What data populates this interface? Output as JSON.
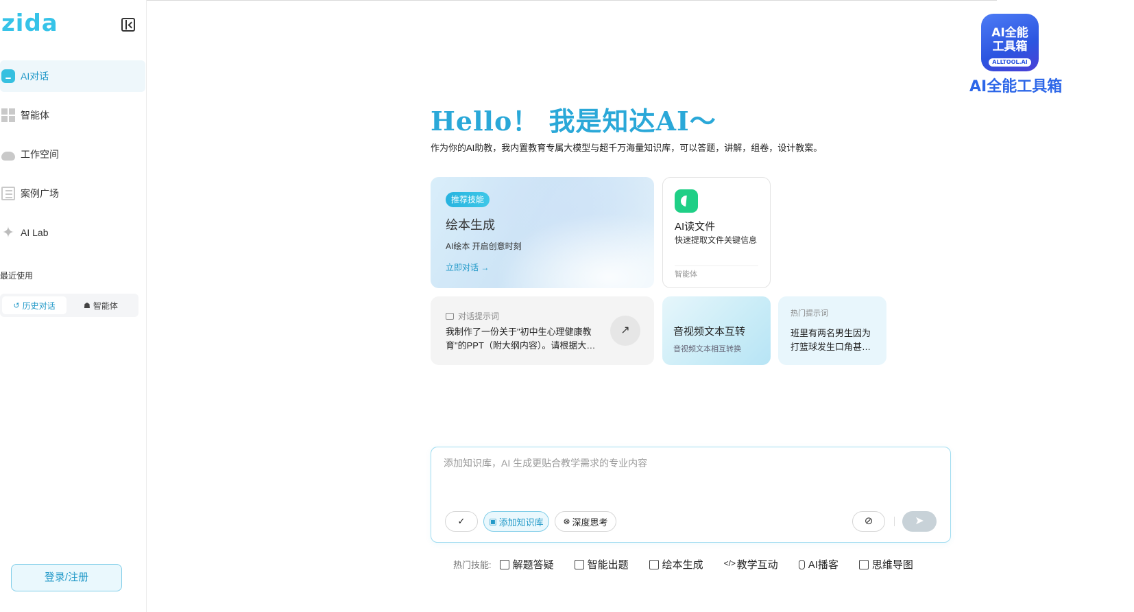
{
  "sidebar": {
    "logo": "zida",
    "nav": [
      {
        "label": "AI对话",
        "icon": "chat-icon",
        "active": true
      },
      {
        "label": "智能体",
        "icon": "grid-icon",
        "active": false
      },
      {
        "label": "工作空间",
        "icon": "cloud-icon",
        "active": false
      },
      {
        "label": "案例广场",
        "icon": "list-icon",
        "active": false
      },
      {
        "label": "AI Lab",
        "icon": "sparkle-icon",
        "active": false
      }
    ],
    "recent_title": "最近使用",
    "recent_tabs": [
      {
        "label": "历史对话",
        "icon": "history-icon",
        "active": true
      },
      {
        "label": "智能体",
        "icon": "agent-icon",
        "active": false
      }
    ],
    "login_label": "登录/注册"
  },
  "main": {
    "hello": "Hello！ 我是知达AI～",
    "subtitle": "作为你的AI助教，我内置教育专属大模型与超千万海量知识库，可以答题，讲解，组卷，设计教案。",
    "feature_card": {
      "badge": "推荐技能",
      "title": "绘本生成",
      "desc": "AI绘本 开启创意时刻",
      "link": "立即对话 →"
    },
    "agent_card": {
      "title": "AI读文件",
      "desc": "快速提取文件关键信息",
      "tag": "智能体"
    },
    "prompt_card": {
      "label": "对话提示词",
      "text": "我制作了一份关于\"初中生心理健康教育\"的PPT（附大纲内容）。请根据大纲内容生成演讲稿。",
      "arrow": "↗"
    },
    "av_card": {
      "title": "音视频文本互转",
      "desc": "音视频文本相互转换"
    },
    "hot_card": {
      "label": "热门提示词",
      "text": "班里有两名男生因为打篮球发生口角甚至动手，应该如何处理？"
    }
  },
  "input": {
    "placeholder": "添加知识库，AI 生成更贴合教学需求的专业内容",
    "check_label": "✓",
    "kb_label": "添加知识库",
    "deep_label": "深度思考",
    "attach_icon": "paperclip-icon",
    "send_icon": "send-icon"
  },
  "hot_skills": {
    "label": "热门技能:",
    "items": [
      {
        "label": "解题答疑",
        "icon": "solve-icon"
      },
      {
        "label": "智能出题",
        "icon": "quiz-icon"
      },
      {
        "label": "绘本生成",
        "icon": "image-icon"
      },
      {
        "label": "教学互动",
        "icon": "code-icon"
      },
      {
        "label": "AI播客",
        "icon": "mic-icon"
      },
      {
        "label": "思维导图",
        "icon": "mindmap-icon"
      }
    ]
  },
  "brand": {
    "box_line1": "AI全能",
    "box_line2": "工具箱",
    "box_tag": "ALLTOOL.AI",
    "name": "AI全能工具箱"
  },
  "colors": {
    "accent": "#2aa8d8",
    "active_bg": "#eef7fb",
    "brand_blue": "#2c66e8"
  }
}
